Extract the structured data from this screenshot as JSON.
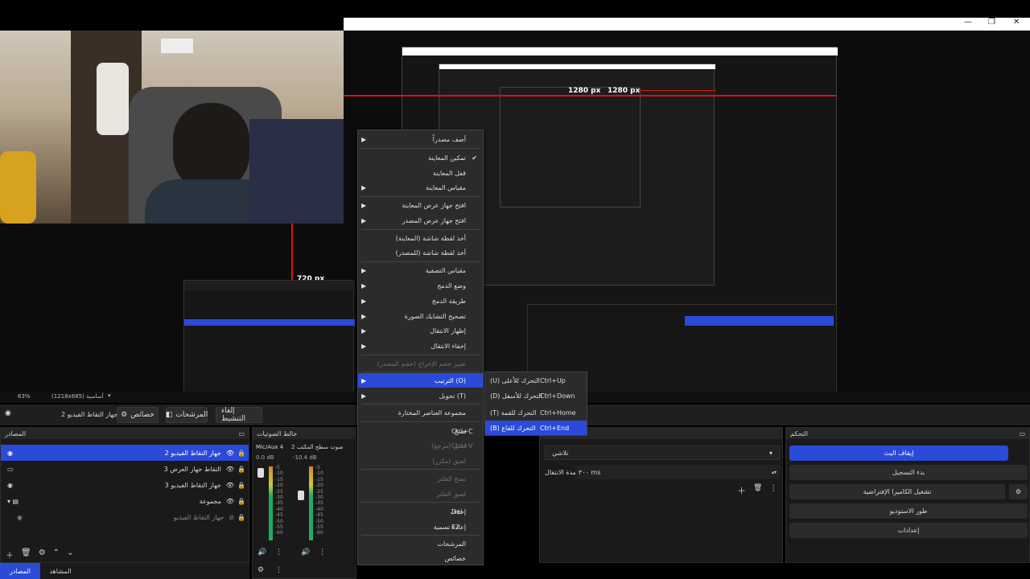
{
  "window": {
    "minimize": "—",
    "maximize": "❐",
    "close": "✕"
  },
  "preview": {
    "label_1280": "1280 px",
    "label_720": "720 px",
    "label_1280_small": "1280 px",
    "nested_zoom": "63%",
    "nested_res": "(1218x685) أساسية"
  },
  "status": {
    "zoom": "63%",
    "resolution": "(1218x685) أساسية"
  },
  "toolbar": {
    "scene_name": "جهاز التقاط الفيديو 2",
    "properties": "خصائص",
    "filters": "المرشحات",
    "deactivate": "إلغاء التنشيط"
  },
  "sources": {
    "title": "المصادر",
    "items": [
      {
        "label": "جهاز التقاط الفيديو 2",
        "selected": true
      },
      {
        "label": "التقاط جهاز العرض 3",
        "selected": false
      },
      {
        "label": "جهاز التقاط الفيديو 3",
        "selected": false
      },
      {
        "label": "مجموعة",
        "selected": false
      },
      {
        "label": "جهاز التقاط الفيديو",
        "selected": false
      }
    ],
    "tab_sources": "المصادر",
    "tab_scenes": "المشاهد"
  },
  "mixer": {
    "title": "خالط الصوتيات",
    "ch1_name": "Mic/Aux 4",
    "ch1_db": "0.0 dB",
    "ch2_name": "صوت سطح المكتب 2",
    "ch2_db": "-10.4 dB",
    "scale": [
      "-5",
      "-10",
      "-15",
      "-20",
      "-25",
      "-30",
      "-35",
      "-40",
      "-45",
      "-50",
      "-55",
      "-60"
    ]
  },
  "transitions": {
    "type": "تلاشي",
    "duration_label": "مدة الانتقال",
    "duration_value": "٣٠٠ ms"
  },
  "controls": {
    "title": "التحكم",
    "stop_stream": "إيقاف البث",
    "start_record": "بدء التسجيل",
    "virtual_cam": "تشغيل الكاميرا الإفتراضية",
    "studio_mode": "طور الاستوديو",
    "settings": "إعدادات"
  },
  "menu": {
    "add_source": "أضف مصدراً",
    "enable_preview": "تمكين المعاينة",
    "lock_preview": "قفل المعاينة",
    "preview_scale": "مقياس المعاينة",
    "open_preview_projector": "افتح جهاز عرض المعاينة",
    "open_source_projector": "افتح جهاز عرض المصدر",
    "screenshot_preview": "أخذ لقطة شاشة (المعاينة)",
    "screenshot_source": "أخذ لقطة شاشة (للمصدر)",
    "scale_filtering": "مقياس التصفية",
    "blend_mode": "وضع الدمج",
    "blend_method": "طريقة الدمج",
    "deinterlace": "تصحيح التشابك الصورة",
    "show_transition": "إظهار الانتقال",
    "hide_transition": "إخفاء الانتقال",
    "resize_output": "تغيير حجم الإخراج (حجم المصدر)",
    "order": "(O) الترتيب",
    "transform": "(T) تحويل",
    "group_selected": "مجموعة العناصر المختارة",
    "copy": "نسخ",
    "copy_sc": "Ctrl+C",
    "paste_ref": "لصق (مرجع)",
    "paste_ref_sc": "Ctrl+V",
    "paste_dup": "لصق (مكرر)",
    "copy_filters": "نسخ الفلتر",
    "paste_filters": "لصق الفلتر",
    "remove": "إحذف",
    "remove_sc": "Del",
    "rename": "إعادة تسمية",
    "rename_sc": "F2",
    "filters": "المرشحات",
    "properties": "خصائص"
  },
  "submenu": {
    "move_up": "(U) التحرك للأعلى",
    "move_up_sc": "Ctrl+Up",
    "move_down": "(D) التحرك للأسفل",
    "move_down_sc": "Ctrl+Down",
    "move_top": "(T) التحرك للقمة",
    "move_top_sc": "Ctrl+Home",
    "move_bottom": "(B) التحرك للقاع",
    "move_bottom_sc": "Ctrl+End"
  },
  "colors": {
    "accent": "#2a4ad8",
    "guide": "#dd1111"
  }
}
